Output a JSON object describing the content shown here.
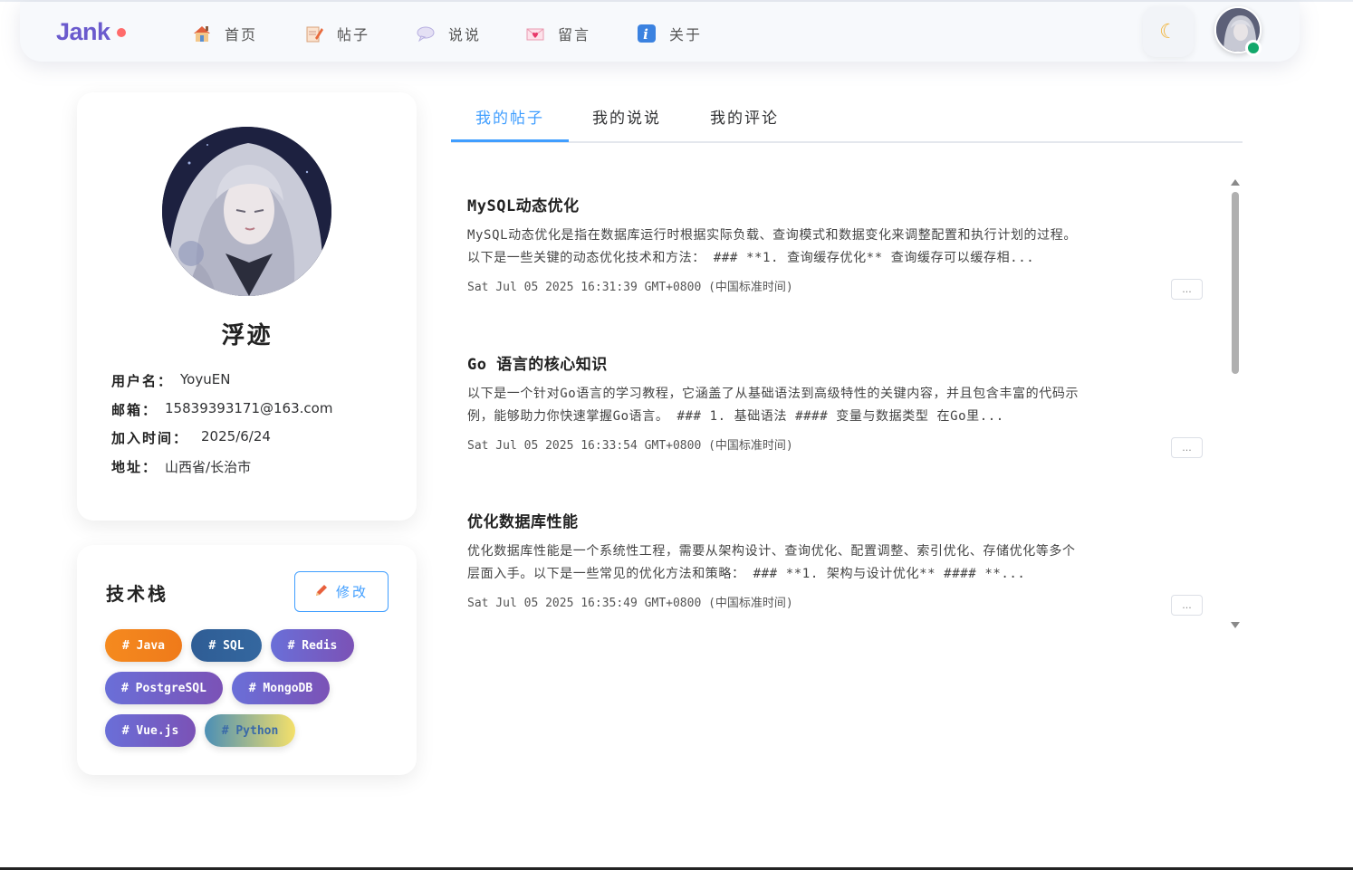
{
  "header": {
    "logo": "Jank",
    "nav": [
      {
        "label": "首页",
        "icon": "house-icon"
      },
      {
        "label": "帖子",
        "icon": "memo-icon"
      },
      {
        "label": "说说",
        "icon": "speech-bubble-icon"
      },
      {
        "label": "留言",
        "icon": "love-letter-icon"
      },
      {
        "label": "关于",
        "icon": "info-icon"
      }
    ],
    "theme_icon": "☾"
  },
  "profile": {
    "name": "浮迹",
    "username_label": "用户名：",
    "username": "YoyuEN",
    "email_label": "邮箱：",
    "email": "15839393171@163.com",
    "joined_label": "加入时间：",
    "joined": "2025/6/24",
    "address_label": "地址：",
    "address": "山西省/长治市"
  },
  "tech_stack": {
    "title": "技术栈",
    "edit_label": "修改",
    "tags": [
      "# Java",
      "# SQL",
      "# Redis",
      "# PostgreSQL",
      "# MongoDB",
      "# Vue.js",
      "# Python"
    ]
  },
  "tabs": [
    "我的帖子",
    "我的说说",
    "我的评论"
  ],
  "posts": [
    {
      "title": "MySQL动态优化",
      "line1": "MySQL动态优化是指在数据库运行时根据实际负载、查询模式和数据变化来调整配置和执行计划的过程。",
      "line2": "以下是一些关键的动态优化技术和方法： ### **1. 查询缓存优化** 查询缓存可以缓存相...",
      "time": "Sat Jul 05 2025 16:31:39 GMT+0800 (中国标准时间)"
    },
    {
      "title": "Go 语言的核心知识",
      "line1": "以下是一个针对Go语言的学习教程，它涵盖了从基础语法到高级特性的关键内容，并且包含丰富的代码示",
      "line2": "例，能够助力你快速掌握Go语言。 ### 1. 基础语法 #### 变量与数据类型 在Go里...",
      "time": "Sat Jul 05 2025 16:33:54 GMT+0800 (中国标准时间)"
    },
    {
      "title": "优化数据库性能",
      "line1": "优化数据库性能是一个系统性工程，需要从架构设计、查询优化、配置调整、索引优化、存储优化等多个",
      "line2": "层面入手。以下是一些常见的优化方法和策略： ### **1. 架构与设计优化** #### **...",
      "time": "Sat Jul 05 2025 16:35:49 GMT+0800 (中国标准时间)"
    }
  ],
  "more_label": "..."
}
